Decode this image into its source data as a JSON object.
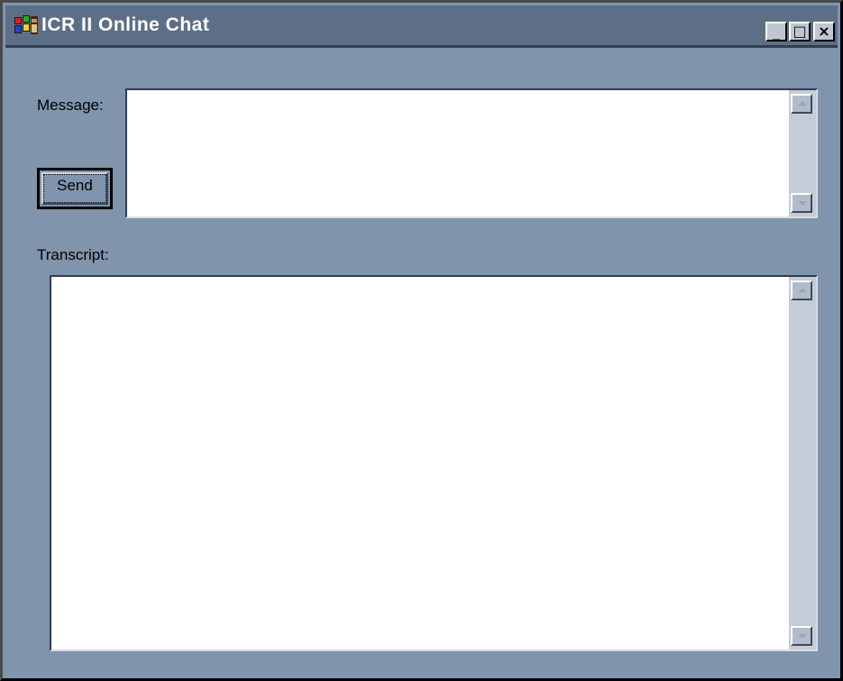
{
  "window": {
    "title": "ICR II Online Chat",
    "controls": {
      "minimize": "_",
      "maximize": "□",
      "close": "×"
    },
    "icon": "windows-flag-icon"
  },
  "message": {
    "label": "Message:",
    "value": "",
    "send_label": "Send"
  },
  "transcript": {
    "label": "Transcript:",
    "value": ""
  },
  "colors": {
    "window_bg": "#8094ac",
    "titlebar_bg": "#5d6f87",
    "input_bg": "#ffffff"
  }
}
